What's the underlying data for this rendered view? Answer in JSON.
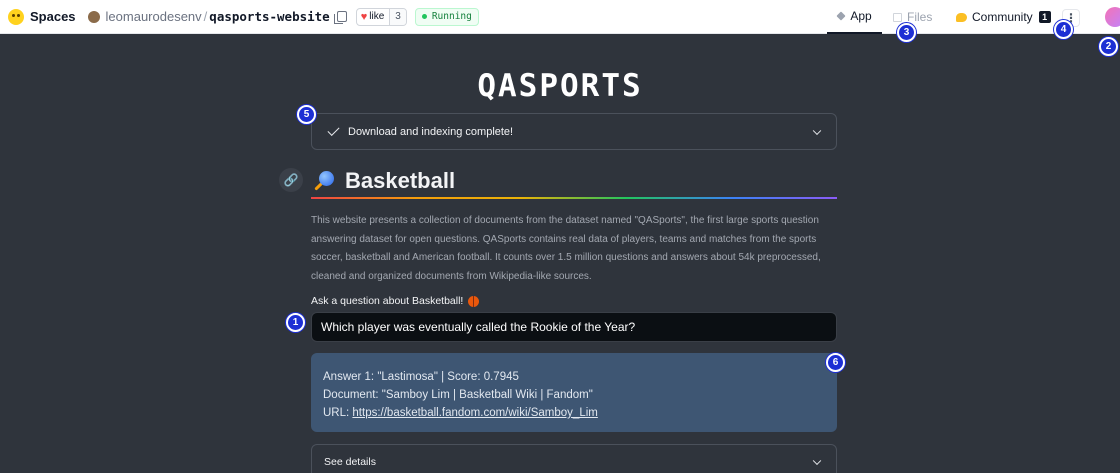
{
  "topbar": {
    "brand": "Spaces",
    "owner": "leomaurodesenv",
    "separator": "/",
    "repo": "qasports-website",
    "like_label": "like",
    "like_count": "3",
    "status": "Running",
    "nav": {
      "app": "App",
      "files": "Files",
      "community": "Community",
      "community_badge": "1"
    },
    "menu_glyph": "⋮"
  },
  "badges": [
    "1",
    "2",
    "3",
    "4",
    "5",
    "6"
  ],
  "main": {
    "logo_text": "QASPORTS",
    "status_message": "Download and indexing complete!",
    "heading": "Basketball",
    "link_glyph": "🔗",
    "description": "This website presents a collection of documents from the dataset named \"QASports\", the first large sports question answering dataset for open questions. QASports contains real data of players, teams and matches from the sports soccer, basketball and American football. It counts over 1.5 million questions and answers about 54k preprocessed, cleaned and organized documents from Wikipedia-like sources.",
    "ask_label": "Ask a question about Basketball!",
    "question_value": "Which player was eventually called the Rookie of the Year?",
    "answer": {
      "line1": "Answer 1: \"Lastimosa\" | Score: 0.7945",
      "line2": "Document: \"Samboy Lim | Basketball Wiki | Fandom\"",
      "url_prefix": "URL: ",
      "url": "https://basketball.fandom.com/wiki/Samboy_Lim"
    },
    "details_label": "See details"
  },
  "colors": {
    "background": "#2f343c",
    "answer_bg": "#3e5673",
    "badge_blue": "#1d2fd4",
    "running_green": "#15803d"
  }
}
